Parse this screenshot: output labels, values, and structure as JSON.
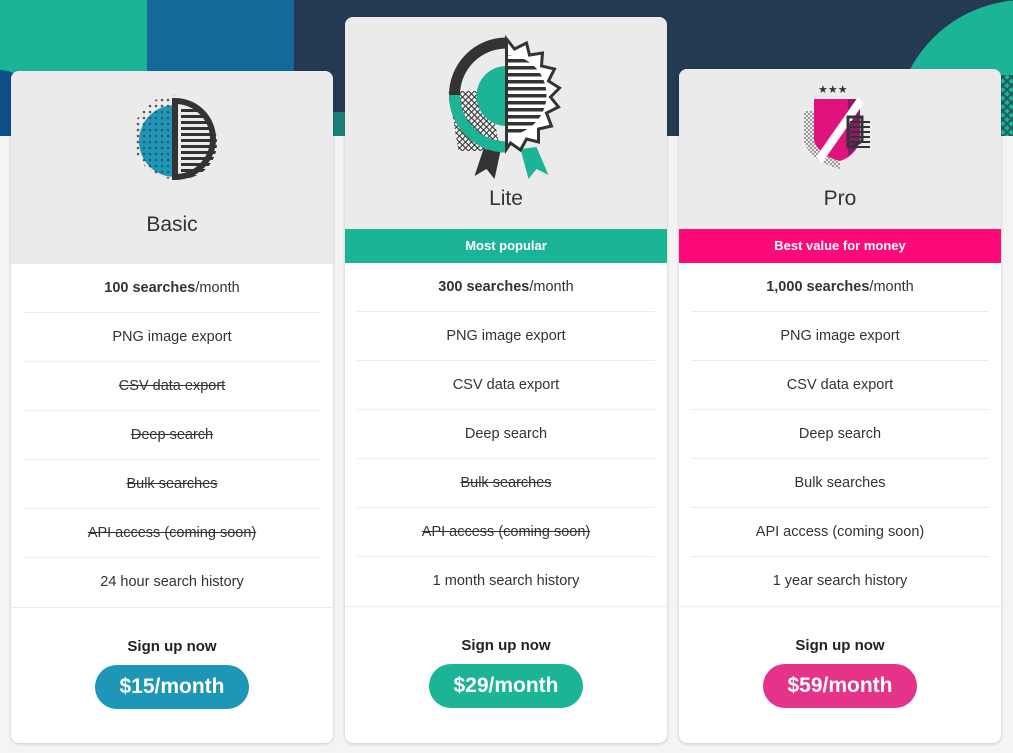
{
  "colors": {
    "teal": "#1cb497",
    "blue": "#1e96b8",
    "pink": "#fd0a78",
    "pink_button": "#e6338a",
    "navy": "#233a52"
  },
  "plans": [
    {
      "name": "Basic",
      "icon": "half-moon-dotted-icon",
      "badge": null,
      "features": [
        {
          "bold": "100 searches",
          "rest": "/month",
          "enabled": true
        },
        {
          "text": "PNG image export",
          "enabled": true
        },
        {
          "text": "CSV data export",
          "enabled": false
        },
        {
          "text": "Deep search",
          "enabled": false
        },
        {
          "text": "Bulk searches",
          "enabled": false
        },
        {
          "text": "API access (coming soon)",
          "enabled": false
        },
        {
          "text": "24 hour search history",
          "enabled": true
        }
      ],
      "cta": "Sign up now",
      "price": "$15/month"
    },
    {
      "name": "Lite",
      "icon": "award-rosette-icon",
      "badge": "Most popular",
      "features": [
        {
          "bold": "300 searches",
          "rest": "/month",
          "enabled": true
        },
        {
          "text": "PNG image export",
          "enabled": true
        },
        {
          "text": "CSV data export",
          "enabled": true
        },
        {
          "text": "Deep search",
          "enabled": true
        },
        {
          "text": "Bulk searches",
          "enabled": false
        },
        {
          "text": "API access (coming soon)",
          "enabled": false
        },
        {
          "text": "1 month search history",
          "enabled": true
        }
      ],
      "cta": "Sign up now",
      "price": "$29/month"
    },
    {
      "name": "Pro",
      "icon": "shield-stars-icon",
      "badge": "Best value for money",
      "features": [
        {
          "bold": "1,000 searches",
          "rest": "/month",
          "enabled": true
        },
        {
          "text": "PNG image export",
          "enabled": true
        },
        {
          "text": "CSV data export",
          "enabled": true
        },
        {
          "text": "Deep search",
          "enabled": true
        },
        {
          "text": "Bulk searches",
          "enabled": true
        },
        {
          "text": "API access (coming soon)",
          "enabled": true
        },
        {
          "text": "1 year search history",
          "enabled": true
        }
      ],
      "cta": "Sign up now",
      "price": "$59/month"
    }
  ]
}
